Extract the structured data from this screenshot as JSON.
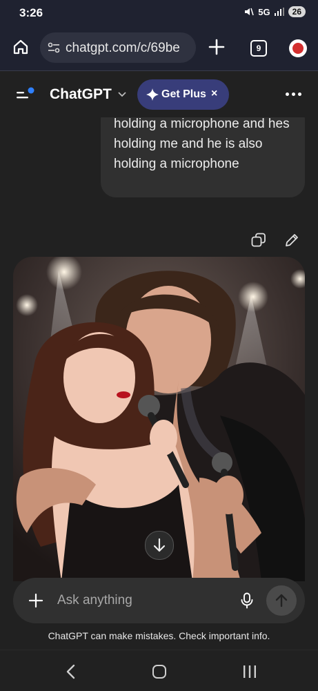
{
  "status_bar": {
    "time": "3:26",
    "network": "5G",
    "battery": "26"
  },
  "browser": {
    "url": "chatgpt.com/c/69be",
    "tab_count": "9"
  },
  "header": {
    "title": "ChatGPT",
    "upgrade_label": "Get Plus",
    "dismiss_label": "×"
  },
  "chat": {
    "user_message": "have a show and stage and im holding a microphone and hes holding me and he is also holding a microphone"
  },
  "composer": {
    "placeholder": "Ask anything"
  },
  "footer": {
    "disclaimer": "ChatGPT can make mistakes. Check important info."
  },
  "icons": [
    "home-icon",
    "tune-icon",
    "plus-icon",
    "tab-switcher-icon",
    "extension-icon",
    "menu-icon",
    "chevron-down-icon",
    "sparkle-icon",
    "more-icon",
    "copy-icon",
    "edit-icon",
    "arrow-down-icon",
    "mic-icon",
    "send-icon",
    "nav-back-icon",
    "nav-home-icon",
    "nav-recents-icon"
  ],
  "colors": {
    "background": "#212121",
    "bubble": "#303030",
    "upgrade": "#383d7a",
    "accent": "#2f80ff"
  }
}
